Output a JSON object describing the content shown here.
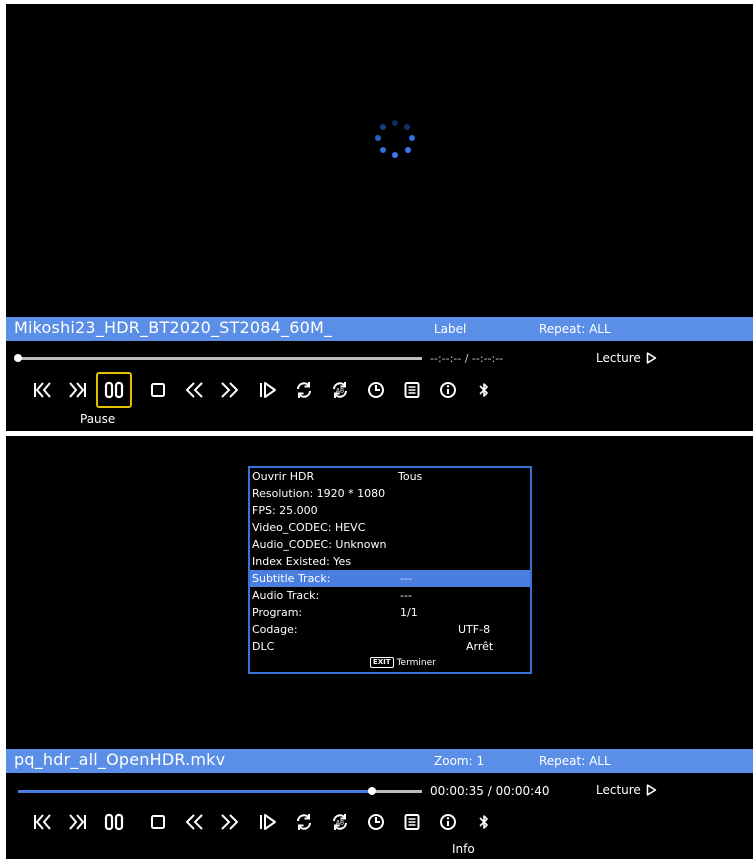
{
  "player1": {
    "filename": "Mikoshi23_HDR_BT2020_ST2084_60M_",
    "label": "Label",
    "repeat": "Repeat: ALL",
    "time": "--:--:-- / --:--:--",
    "progress": 0,
    "status": "Lecture",
    "selected_control_label": "Pause",
    "loading_spinner": "spinner-icon"
  },
  "player2": {
    "filename": "pq_hdr_all_OpenHDR.mkv",
    "zoom": "Zoom: 1",
    "repeat": "Repeat: ALL",
    "time": "00:00:35 / 00:00:40",
    "progress": 0.875,
    "status": "Lecture",
    "selected_control_label": "Info"
  },
  "info_panel": {
    "header_left": "Ouvrir HDR",
    "header_right": "Tous",
    "resolution": "Resolution: 1920 * 1080",
    "fps": "FPS: 25.000",
    "video_codec": "Video_CODEC: HEVC",
    "audio_codec": "Audio_CODEC: Unknown",
    "index_existed": "Index Existed: Yes",
    "subtitle_label": "Subtitle Track:",
    "subtitle_value": "---",
    "audio_label": "Audio Track:",
    "audio_value": "---",
    "program_label": "Program:",
    "program_value": "1/1",
    "codage_label": "Codage:",
    "codage_value": "UTF-8",
    "dlc_label": "DLC",
    "dlc_value": "Arrêt",
    "exit_key": "EXIT",
    "exit_label": "Terminer"
  },
  "controls": [
    "previous-icon",
    "next-icon",
    "pause-icon",
    "stop-icon",
    "rewind-icon",
    "fast-forward-icon",
    "slow-motion-icon",
    "repeat-icon",
    "repeat-ab-icon",
    "clock-icon",
    "playlist-icon",
    "info-icon",
    "bluetooth-icon"
  ],
  "colors": {
    "accent": "#5b8ee6",
    "highlight": "#4a7fe0",
    "selection": "#e0c000",
    "background": "#000000"
  }
}
